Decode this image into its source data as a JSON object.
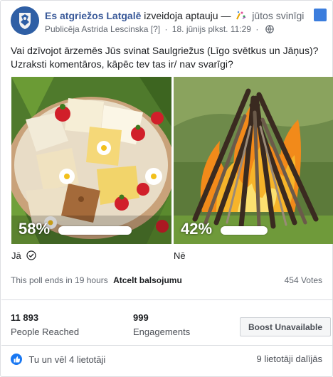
{
  "header": {
    "page_name": "Es atgriežos Latgalē",
    "action_text": "izveidoja aptauju —",
    "feeling": "jūtos svinīgi",
    "published_by": "Publicēja Astrida Lescinska",
    "info_marker": "[?]",
    "separator": "·",
    "timestamp": "18. jūnijs plkst. 11:29",
    "separator2": "·"
  },
  "post": {
    "question": "Vai dzīvojot ārzemēs Jūs svinat Saulgriežus (Līgo svētkus un Jāņus)? Uzraksti komentāros, kāpēc tev tas ir/ nav svarīgi?"
  },
  "poll": {
    "options": [
      {
        "label": "Jā",
        "percent_text": "58%",
        "percent": 58,
        "selected": true,
        "image": "cheese-platter"
      },
      {
        "label": "Nē",
        "percent_text": "42%",
        "percent": 42,
        "selected": false,
        "image": "bonfire"
      }
    ],
    "ends_text": "This poll ends in 19 hours",
    "undo_label": "Atcelt balsojumu",
    "votes_text": "454 Votes"
  },
  "insights": {
    "reached_value": "11 893",
    "reached_label": "People Reached",
    "engagements_value": "999",
    "engagements_label": "Engagements",
    "boost_label": "Boost Unavailable"
  },
  "footer": {
    "likes_text": "Tu un vēl 4 lietotāji",
    "shares_text": "9 lietotāji dalījās"
  },
  "colors": {
    "link": "#385898",
    "like_blue": "#1877f2",
    "bar_white": "#ffffff"
  }
}
